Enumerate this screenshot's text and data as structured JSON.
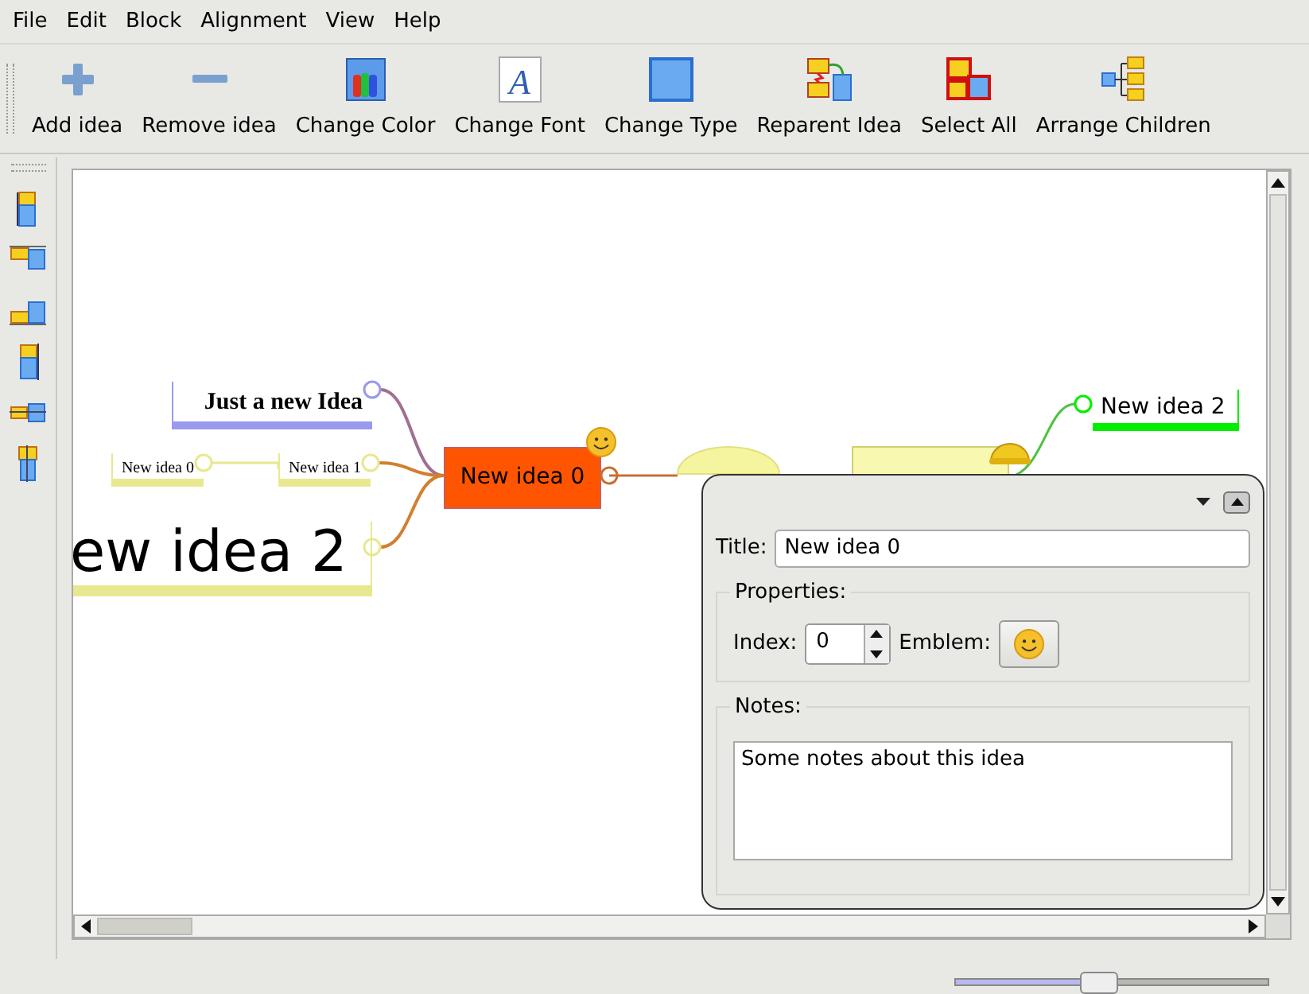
{
  "menu": [
    "File",
    "Edit",
    "Block",
    "Alignment",
    "View",
    "Help"
  ],
  "toolbar": [
    {
      "label": "Add idea"
    },
    {
      "label": "Remove idea"
    },
    {
      "label": "Change Color"
    },
    {
      "label": "Change Font",
      "icon_glyph": "A"
    },
    {
      "label": "Change Type"
    },
    {
      "label": "Reparent Idea"
    },
    {
      "label": "Select All"
    },
    {
      "label": "Arrange Children"
    }
  ],
  "mindmap": {
    "central": {
      "title": "New idea 0",
      "color": "#ff5500"
    },
    "left": [
      {
        "title": "Just a new Idea",
        "color": "#9999ee",
        "kind": "serif"
      },
      {
        "title": "New idea 1",
        "color": "#e8e890",
        "kind": "small"
      },
      {
        "title": "New idea 0",
        "color": "#e8e890",
        "kind": "small"
      },
      {
        "title": "ew idea 2",
        "color": "#e8e890",
        "kind": "large"
      }
    ],
    "right": [
      {
        "title": "New idea 2",
        "color": "#00ee00",
        "kind": "plain"
      }
    ]
  },
  "panel": {
    "title_label": "Title:",
    "title_value": "New idea 0",
    "properties_label": "Properties:",
    "index_label": "Index:",
    "index_value": "0",
    "emblem_label": "Emblem:",
    "notes_label": "Notes:",
    "notes_value": "Some notes about this idea"
  },
  "zoom": {
    "level": 0.46
  }
}
